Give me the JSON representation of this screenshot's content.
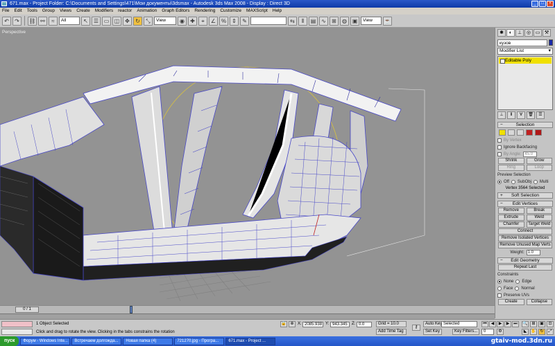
{
  "titlebar": {
    "title": "671.max     - Project Folder: C:\\Documents and Settings\\471\\Мои документы\\3dsmax     - Autodesk 3ds Max 2008     - Display : Direct 3D"
  },
  "menu": [
    "File",
    "Edit",
    "Tools",
    "Group",
    "Views",
    "Create",
    "Modifiers",
    "reactor",
    "Animation",
    "Graph Editors",
    "Rendering",
    "Customize",
    "MAXScript",
    "Help"
  ],
  "toolbar": {
    "selection_filter": "All",
    "reference_coord": "View",
    "named_selection": "",
    "render_view": "View"
  },
  "viewport": {
    "label": "Perspective"
  },
  "command_panel": {
    "object_name": "кузов",
    "object_color": "#1a2aa8",
    "modifier_list": "Modifier List",
    "stack_item": "Editable Poly",
    "selection": {
      "rollout": "Selection",
      "by_vertex": "By Vertex",
      "ignore_backfacing": "Ignore Backfacing",
      "by_angle": "By Angle:",
      "by_angle_value": "45.0",
      "shrink": "Shrink",
      "grow": "Grow",
      "ring": "Ring",
      "loop": "Loop",
      "preview_selection": "Preview Selection",
      "preview_off": "Off",
      "preview_subobj": "SubObj",
      "preview_multi": "Multi",
      "status": "Vertex 3564 Selected"
    },
    "soft_selection": {
      "rollout": "Soft Selection"
    },
    "edit_vertices": {
      "rollout": "Edit Vertices",
      "remove": "Remove",
      "break": "Break",
      "extrude": "Extrude",
      "weld": "Weld",
      "chamfer": "Chamfer",
      "target_weld": "Target Weld",
      "connect": "Connect",
      "remove_isolated": "Remove Isolated Vertices",
      "remove_unused": "Remove Unused Map Verts",
      "weight_label": "Weight:",
      "weight_value": "1.0"
    },
    "edit_geometry": {
      "rollout": "Edit Geometry",
      "repeat_last": "Repeat Last",
      "constraints": "Constraints",
      "none": "None",
      "edge": "Edge",
      "face": "Face",
      "normal": "Normal",
      "preserve_uvs": "Preserve UVs",
      "create": "Create",
      "collapse": "Collapse"
    }
  },
  "timeline": {
    "frame": "0 / 1",
    "position": 0.0
  },
  "status": {
    "objects_selected": "1 Object Selected",
    "prompt": "Click and drag to rotate the view.  Clicking in the tabs constrains the rotation",
    "x_label": "X:",
    "x_value": "2085.938",
    "y_label": "Y:",
    "y_value": "943.345",
    "z_label": "Z:",
    "z_value": "0.0",
    "grid": "Grid = 10.0",
    "add_time_tag": "Add Time Tag",
    "auto_key": "Auto Key",
    "set_key": "Set Key",
    "key_mode": "Selected",
    "key_filters": "Key Filters...",
    "current_frame": "0"
  },
  "taskbar": {
    "start": "пуск",
    "tasks": [
      "Форум - Windows Inte...",
      "Встречаем долгожда...",
      "Новая папка (4)",
      "721270.jpg - Програ...",
      "671.max - Project ..."
    ],
    "watermark": "gtaiv-mod.3dn.ru"
  }
}
